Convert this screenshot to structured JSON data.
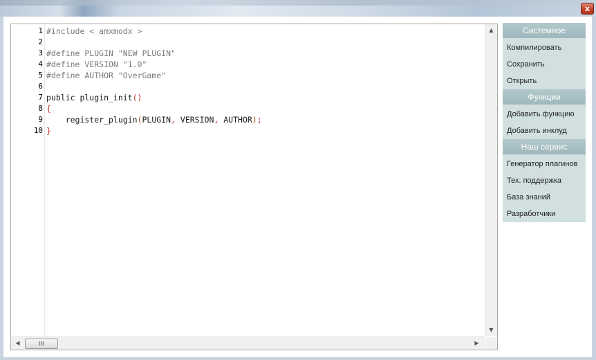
{
  "window": {
    "close_glyph": "x"
  },
  "editor": {
    "lines": [
      {
        "n": "1",
        "tokens": [
          {
            "t": "#include < amxmodx >",
            "c": "pre"
          }
        ]
      },
      {
        "n": "2",
        "tokens": []
      },
      {
        "n": "3",
        "tokens": [
          {
            "t": "#define PLUGIN \"NEW PLUGIN\"",
            "c": "pre"
          }
        ]
      },
      {
        "n": "4",
        "tokens": [
          {
            "t": "#define VERSION \"1.0\"",
            "c": "pre"
          }
        ]
      },
      {
        "n": "5",
        "tokens": [
          {
            "t": "#define AUTHOR \"OverGame\"",
            "c": "pre"
          }
        ]
      },
      {
        "n": "6",
        "tokens": []
      },
      {
        "n": "7",
        "tokens": [
          {
            "t": "public plugin_init",
            "c": "plain"
          },
          {
            "t": "()",
            "c": "red"
          }
        ]
      },
      {
        "n": "8",
        "tokens": [
          {
            "t": "{",
            "c": "red"
          }
        ]
      },
      {
        "n": "9",
        "tokens": [
          {
            "t": "    register_plugin",
            "c": "plain"
          },
          {
            "t": "(",
            "c": "red"
          },
          {
            "t": "PLUGIN",
            "c": "plain"
          },
          {
            "t": ", ",
            "c": "red"
          },
          {
            "t": "VERSION",
            "c": "plain"
          },
          {
            "t": ", ",
            "c": "red"
          },
          {
            "t": "AUTHOR",
            "c": "plain"
          },
          {
            "t": ");",
            "c": "red"
          }
        ]
      },
      {
        "n": "10",
        "tokens": [
          {
            "t": "}",
            "c": "red"
          }
        ]
      }
    ],
    "hscroll_thumb_grip": "III"
  },
  "sidebar": {
    "sections": [
      {
        "header": "Системное",
        "items": [
          "Компилировать",
          "Сохранить",
          "Открыть"
        ]
      },
      {
        "header": "Функции",
        "items": [
          "Добавить функцию",
          "Добавить инклуд"
        ]
      },
      {
        "header": "Наш сервис",
        "items": [
          "Генератор плагинов",
          "Тех. поддержка",
          "База знаний",
          "Разработчики"
        ]
      }
    ]
  }
}
